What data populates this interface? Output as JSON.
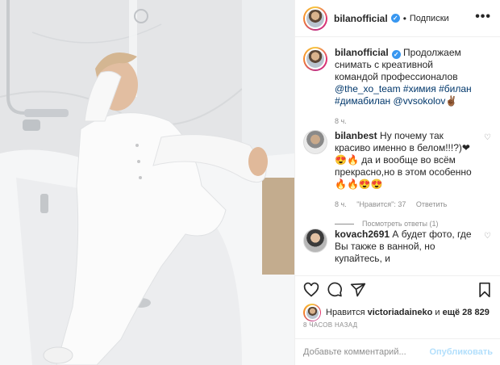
{
  "header": {
    "username": "bilanofficial",
    "separator": "•",
    "follow_label": "Подписки",
    "more_label": "•••"
  },
  "caption": {
    "username": "bilanofficial",
    "text_1": "Продолжаем снимать с креативной командой профессионалов",
    "mention_1": "@the_xo_team",
    "tags": "#химия #билан #димабилан",
    "mention_2": "@vvsokolov",
    "emoji": "✌🏾",
    "time": "8 ч."
  },
  "comments": [
    {
      "username": "bilanbest",
      "text": "Ну почему так красиво именно в белом!!!?)❤😍🔥 да и вообще во всём прекрасно,но в этом особенно 🔥🔥😍😍",
      "time": "8 ч.",
      "likes": "\"Нравится\": 37",
      "reply": "Ответить",
      "view_replies": "Посмотреть ответы (1)"
    },
    {
      "username": "kovach2691",
      "text": "А будет фото, где Вы также в ванной, но купайтесь, и"
    }
  ],
  "likes": {
    "prefix": "Нравится",
    "user": "victoriadaineko",
    "and": "и",
    "rest": "ещё 28 829"
  },
  "timestamp": "8 ЧАСОВ НАЗАД",
  "add_comment": {
    "placeholder": "Добавьте комментарий...",
    "publish_label": "Опубликовать"
  },
  "icons": {
    "like": "heart-icon",
    "comment": "comment-icon",
    "share": "share-icon",
    "save": "bookmark-icon"
  },
  "colors": {
    "link": "#00376b",
    "verified": "#3897f0",
    "publish_disabled": "#b2dffc",
    "heart_red": "#ed4956"
  }
}
